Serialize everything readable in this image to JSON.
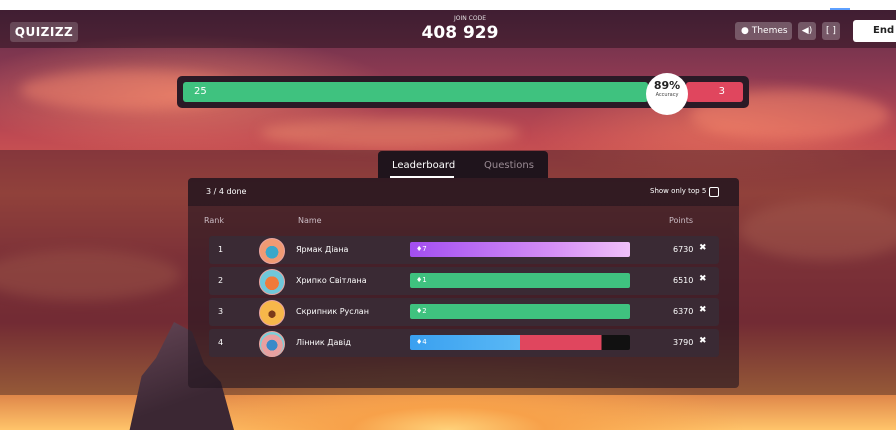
{
  "header": {
    "logo": "QUIZIZZ",
    "join_label": "JOIN CODE",
    "join_code": "408 929",
    "themes_label": "Themes",
    "end_label": "End"
  },
  "accuracy": {
    "correct": "25",
    "incorrect": "3",
    "percent": "89%",
    "label": "Accuracy",
    "percent_value": 89
  },
  "tabs": [
    "Leaderboard",
    "Questions"
  ],
  "board": {
    "done": "3 / 4 done",
    "show_top": "Show only top 5",
    "col_rank": "Rank",
    "col_name": "Name",
    "col_points": "Points",
    "rows": [
      {
        "rank": "1",
        "name": "Ярмак Діана",
        "streak": "7",
        "points": "6730",
        "bar": "purple"
      },
      {
        "rank": "2",
        "name": "Хрипко Світлана",
        "streak": "1",
        "points": "6510",
        "bar": "green"
      },
      {
        "rank": "3",
        "name": "Скрипник Руслан",
        "streak": "2",
        "points": "6370",
        "bar": "green"
      },
      {
        "rank": "4",
        "name": "Лінник Давід",
        "streak": "4",
        "points": "3790",
        "bar": "mixed"
      }
    ]
  },
  "colors": {
    "correct": "#3fc27f",
    "incorrect": "#e0465e",
    "streak_purple": "#a24ef0",
    "accent_blue": "#3aa0f0"
  }
}
